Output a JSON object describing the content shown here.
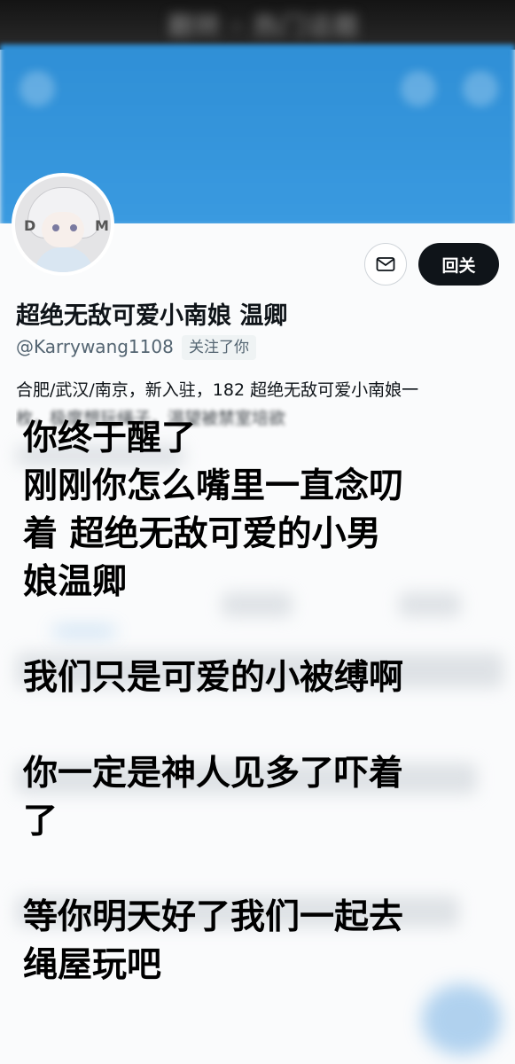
{
  "status_bar": {
    "blurred_text": "翻转 · 热门话题"
  },
  "banner": {
    "color": "#3a9ae0",
    "icons": [
      "back-icon",
      "search-icon",
      "more-icon"
    ]
  },
  "profile": {
    "display_name": "超绝无敌可爱小南娘 温卿",
    "handle": "@Karrywang1108",
    "follows_you": "关注了你",
    "bio_line1": "合肥/武汉/南京，新入驻，182 超绝无敌可爱小南娘一",
    "bio_line2": "枚，极度想玩绳子，渴望被禁室培欲",
    "follow_button_label": "回关",
    "avatar_letters": [
      "D",
      "M"
    ],
    "accent_color": "#0f1419"
  },
  "overlay_caption": {
    "line1": "你终于醒了",
    "line2": "刚刚你怎么嘴里一直念叨",
    "line3": "着  超绝无敌可爱的小男",
    "line4": "娘温卿",
    "line5": "我们只是可爱的小被缚啊",
    "line6": "你一定是神人见多了吓着",
    "line7": "了",
    "line8": "等你明天好了我们一起去",
    "line9": "绳屋玩吧"
  }
}
